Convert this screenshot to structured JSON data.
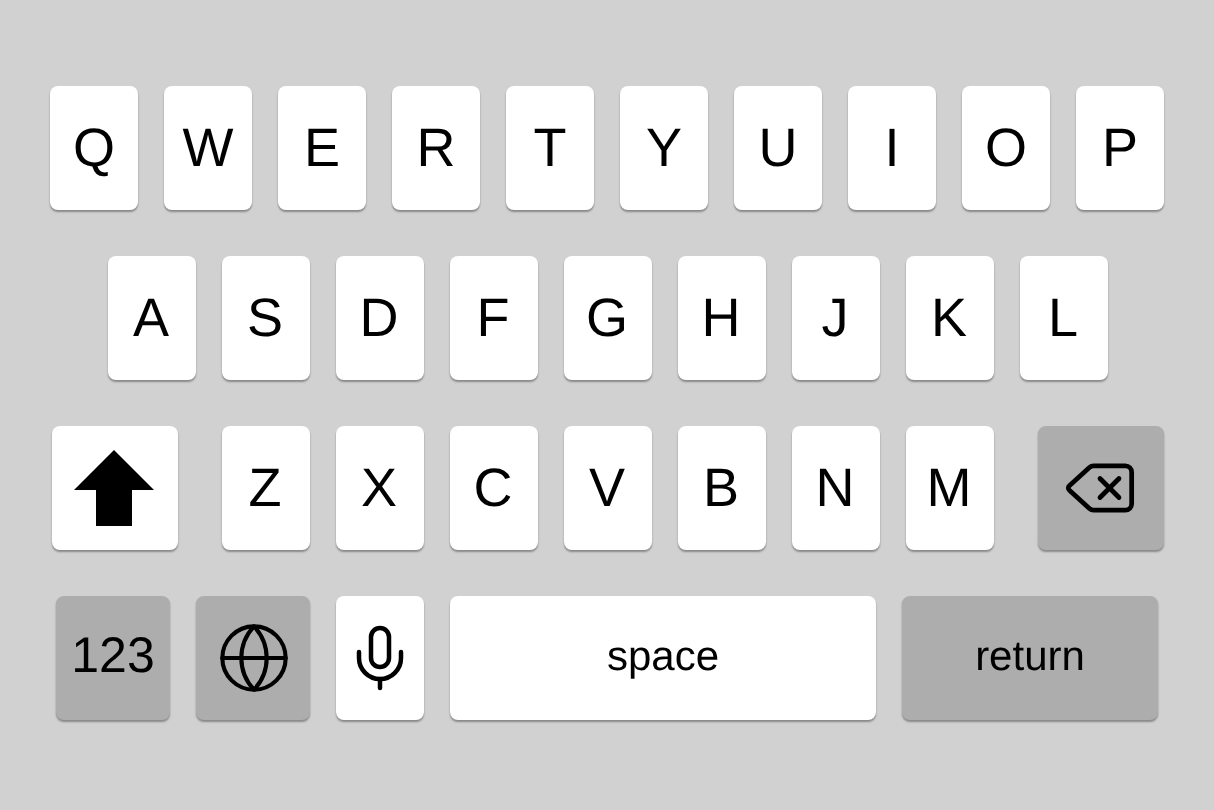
{
  "keyboard": {
    "rows": [
      {
        "keys": [
          {
            "kind": "letter",
            "label": "Q"
          },
          {
            "kind": "letter",
            "label": "W"
          },
          {
            "kind": "letter",
            "label": "E"
          },
          {
            "kind": "letter",
            "label": "R"
          },
          {
            "kind": "letter",
            "label": "T"
          },
          {
            "kind": "letter",
            "label": "Y"
          },
          {
            "kind": "letter",
            "label": "U"
          },
          {
            "kind": "letter",
            "label": "I"
          },
          {
            "kind": "letter",
            "label": "O"
          },
          {
            "kind": "letter",
            "label": "P"
          }
        ]
      },
      {
        "keys": [
          {
            "kind": "letter",
            "label": "A"
          },
          {
            "kind": "letter",
            "label": "S"
          },
          {
            "kind": "letter",
            "label": "D"
          },
          {
            "kind": "letter",
            "label": "F"
          },
          {
            "kind": "letter",
            "label": "G"
          },
          {
            "kind": "letter",
            "label": "H"
          },
          {
            "kind": "letter",
            "label": "J"
          },
          {
            "kind": "letter",
            "label": "K"
          },
          {
            "kind": "letter",
            "label": "L"
          }
        ]
      },
      {
        "keys": [
          {
            "kind": "shift"
          },
          {
            "kind": "letter",
            "label": "Z"
          },
          {
            "kind": "letter",
            "label": "X"
          },
          {
            "kind": "letter",
            "label": "C"
          },
          {
            "kind": "letter",
            "label": "V"
          },
          {
            "kind": "letter",
            "label": "B"
          },
          {
            "kind": "letter",
            "label": "N"
          },
          {
            "kind": "letter",
            "label": "M"
          },
          {
            "kind": "backspace"
          }
        ]
      },
      {
        "keys": [
          {
            "kind": "numbers",
            "label": "123"
          },
          {
            "kind": "globe"
          },
          {
            "kind": "mic"
          },
          {
            "kind": "space",
            "label": "space"
          },
          {
            "kind": "return",
            "label": "return"
          }
        ]
      }
    ]
  }
}
